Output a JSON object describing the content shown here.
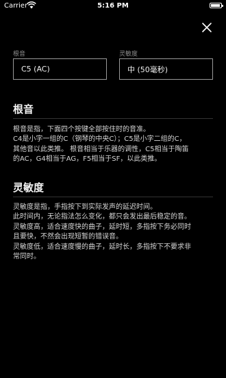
{
  "status_bar": {
    "carrier": "Carrier",
    "time": "5:16 PM",
    "battery_level": 0.95
  },
  "fields": {
    "root": {
      "label": "根音",
      "value": "C5 (AC)"
    },
    "sensitivity": {
      "label": "灵敏度",
      "value": "中 (50毫秒)"
    }
  },
  "sections": {
    "root": {
      "title": "根音",
      "body": "根音是指，下面四个按键全部按住时的音准。\nC4是小字一组的C（钢琴的中央C）；C5是小字二组的C，\n其他音以此类推。 根音相当于乐器的调性，C5相当于陶笛\n的AC，G4相当于AG，F5相当于SF，以此类推。"
    },
    "sensitivity": {
      "title": "灵敏度",
      "body": "灵敏度是指，手指按下到实际发声的延迟时间。\n此时间内，无论指法怎么变化，都只会发出最后稳定的音。\n灵敏度高，适合速度快的曲子，延时短，多指按下务必同时\n且要快，不然会出现短暂的错误音。\n灵敏度低，适合速度慢的曲子，延时长，多指按下不要求非\n常同时。"
    }
  },
  "icons": {
    "close": "close-icon",
    "wifi": "wifi-icon",
    "battery": "battery-icon"
  }
}
